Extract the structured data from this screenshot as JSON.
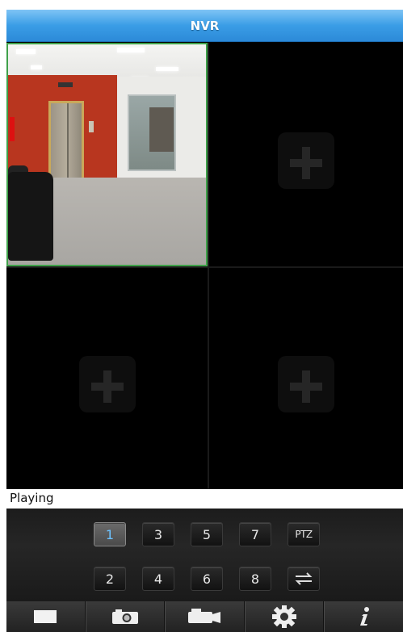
{
  "app": {
    "title": "NVR"
  },
  "status": {
    "text": "Playing"
  },
  "channels": {
    "row1": [
      "1",
      "3",
      "5",
      "7",
      "PTZ"
    ],
    "row2": [
      "2",
      "4",
      "6",
      "8"
    ],
    "selected": "1"
  },
  "toolbar": [
    {
      "icon": "stop-square-icon"
    },
    {
      "icon": "camera-icon"
    },
    {
      "icon": "video-camera-icon"
    },
    {
      "icon": "gear-icon"
    },
    {
      "icon": "info-icon"
    }
  ],
  "colors": {
    "titlebar": "#3a9de6",
    "active_channel_text": "#6cc2ff",
    "selected_cell_border": "#3fa14a"
  }
}
